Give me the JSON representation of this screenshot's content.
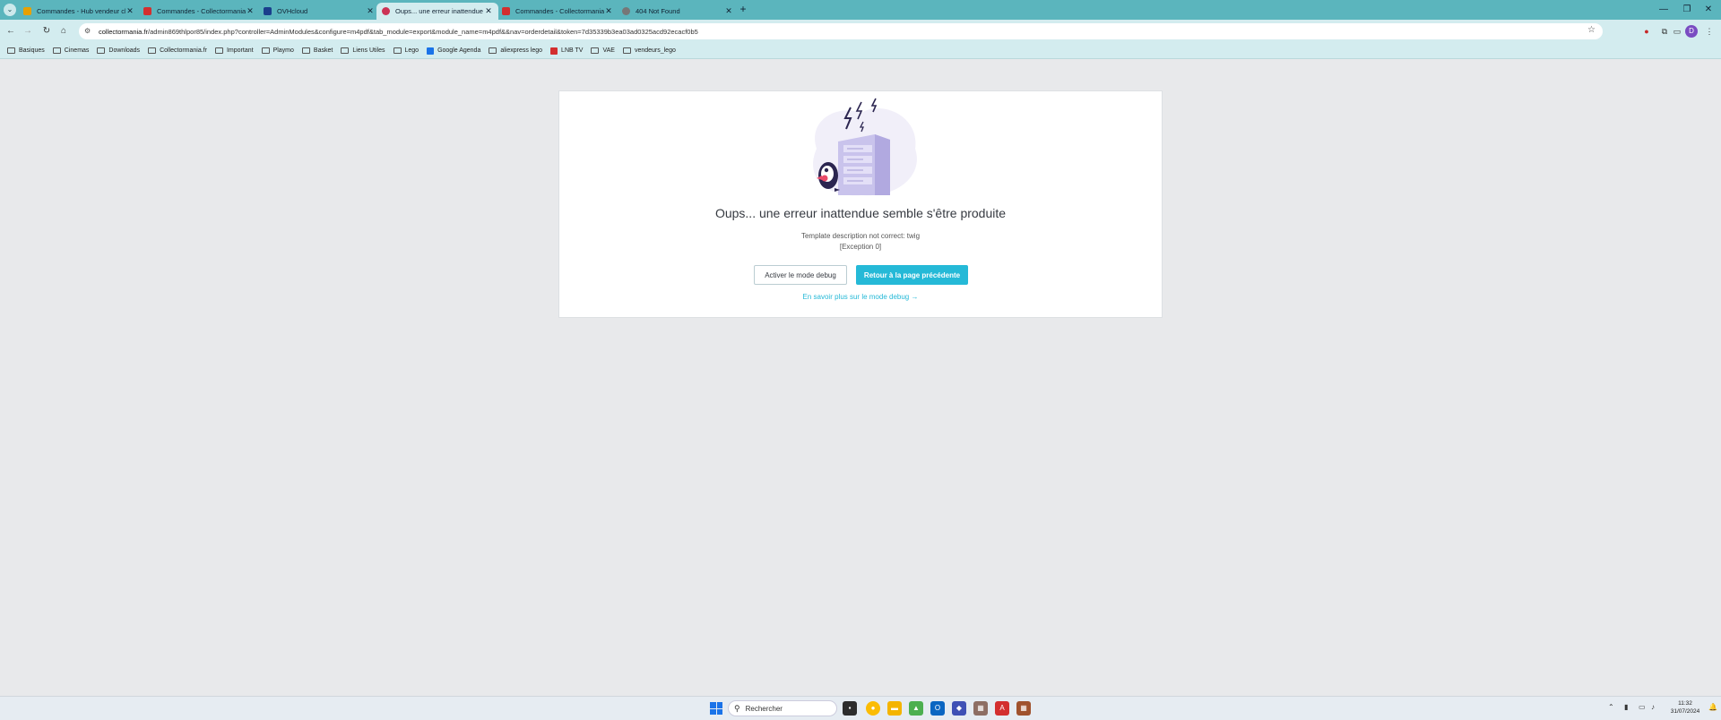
{
  "browser": {
    "tabs": [
      {
        "title": "Commandes - Hub vendeur cli...",
        "favicon_color": "#e8a000",
        "active": false
      },
      {
        "title": "Commandes - Collectormania",
        "favicon_color": "#d32f2f",
        "active": false
      },
      {
        "title": "OVHcloud",
        "favicon_color": "#1a3e8c",
        "active": false
      },
      {
        "title": "Oups... une erreur inattendue s...",
        "favicon_color": "#cc3355",
        "active": true
      },
      {
        "title": "Commandes - Collectormania",
        "favicon_color": "#d32f2f",
        "active": false
      },
      {
        "title": "404 Not Found",
        "favicon_color": "#777777",
        "active": false
      }
    ],
    "url_domain": "collectormania.fr",
    "url_path": "/admin869thlpor85/index.php?controller=AdminModules&configure=m4pdf&tab_module=export&module_name=m4pdf&&nav=orderdetail&token=7d35339b3ea03ad0325acd92ecacf0b5",
    "bookmarks": [
      {
        "label": "Basiques",
        "type": "folder"
      },
      {
        "label": "Cinemas",
        "type": "folder"
      },
      {
        "label": "Downloads",
        "type": "folder"
      },
      {
        "label": "Collectormania.fr",
        "type": "folder"
      },
      {
        "label": "Important",
        "type": "folder"
      },
      {
        "label": "Playmo",
        "type": "folder"
      },
      {
        "label": "Basket",
        "type": "folder"
      },
      {
        "label": "Liens Utiles",
        "type": "folder"
      },
      {
        "label": "Lego",
        "type": "folder"
      },
      {
        "label": "Google Agenda",
        "type": "site",
        "color": "#1a73e8"
      },
      {
        "label": "aliexpress lego",
        "type": "folder"
      },
      {
        "label": "LNB TV",
        "type": "site",
        "color": "#d32f2f"
      },
      {
        "label": "VAE",
        "type": "folder"
      },
      {
        "label": "vendeurs_lego",
        "type": "folder"
      }
    ]
  },
  "page": {
    "error_title": "Oups... une erreur inattendue semble s'être produite",
    "error_message": "Template description not correct: twig",
    "error_code": "[Exception 0]",
    "debug_button": "Activer le mode debug",
    "back_button": "Retour à la page précédente",
    "learn_more": "En savoir plus sur le mode debug →"
  },
  "taskbar": {
    "search_placeholder": "Rechercher",
    "time": "11:32",
    "date": "31/07/2024"
  }
}
